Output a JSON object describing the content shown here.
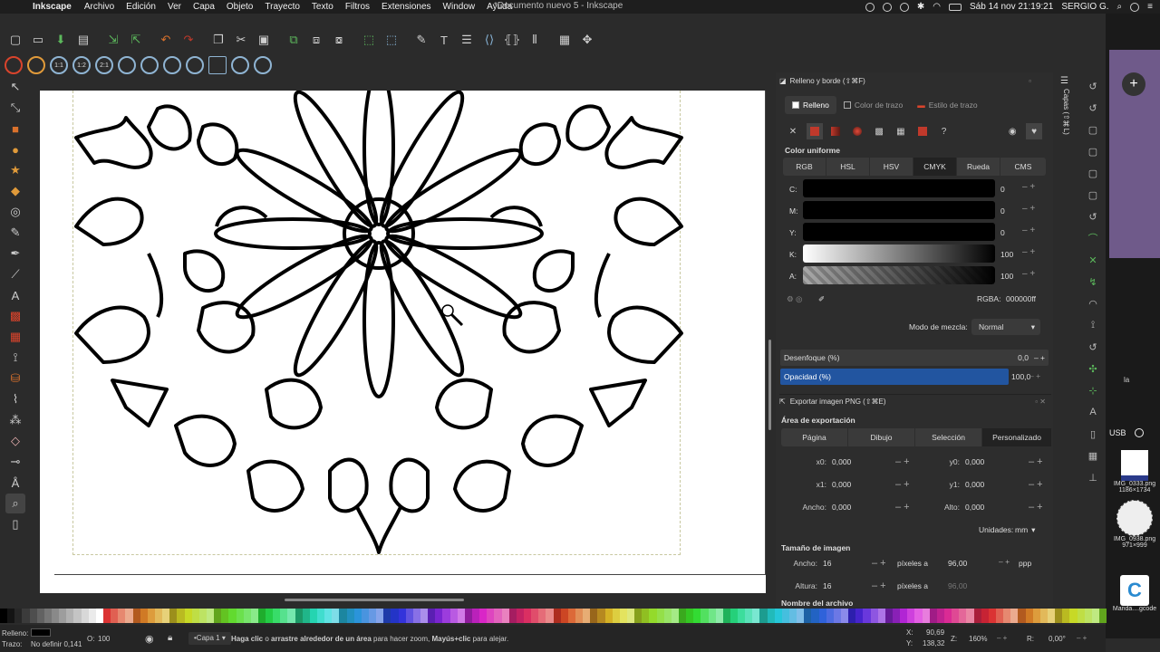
{
  "menubar": {
    "app": "Inkscape",
    "items": [
      "Archivo",
      "Edición",
      "Ver",
      "Capa",
      "Objeto",
      "Trayecto",
      "Texto",
      "Filtros",
      "Extensiones",
      "Window",
      "Ayuda"
    ],
    "doc_title": "*Documento nuevo 5 - Inkscape",
    "datetime": "Sáb 14 nov  21:19:21",
    "user": "SERGIO G."
  },
  "fill_stroke": {
    "title": "Relleno y borde (⇧⌘F)",
    "tabs": [
      "Relleno",
      "Color de trazo",
      "Estilo de trazo"
    ],
    "flat_label": "Color uniforme",
    "modes": [
      "RGB",
      "HSL",
      "HSV",
      "CMYK",
      "Rueda",
      "CMS"
    ],
    "channels": [
      {
        "label": "C:",
        "value": "0"
      },
      {
        "label": "M:",
        "value": "0"
      },
      {
        "label": "Y:",
        "value": "0"
      },
      {
        "label": "K:",
        "value": "100"
      },
      {
        "label": "A:",
        "value": "100"
      }
    ],
    "rgba_label": "RGBA:",
    "rgba": "000000ff",
    "blend_label": "Modo de mezcla:",
    "blend_value": "Normal",
    "blur_label": "Desenfoque (%)",
    "blur_value": "0,0",
    "opacity_label": "Opacidad (%)",
    "opacity_value": "100,0"
  },
  "export": {
    "title": "Exportar imagen PNG (⇧⌘E)",
    "area_label": "Área de exportación",
    "area_buttons": [
      "Página",
      "Dibujo",
      "Selección",
      "Personalizado"
    ],
    "x0_label": "x0:",
    "x0": "0,000",
    "y0_label": "y0:",
    "y0": "0,000",
    "x1_label": "x1:",
    "x1": "0,000",
    "y1_label": "y1:",
    "y1": "0,000",
    "width_label": "Ancho:",
    "width": "0,000",
    "height_label": "Alto:",
    "height": "0,000",
    "units_label": "Unidades:",
    "units": "mm",
    "image_size_label": "Tamaño de imagen",
    "img_w_label": "Ancho:",
    "img_w": "16",
    "img_h_label": "Altura:",
    "img_h": "16",
    "px_at": "píxeles a",
    "dpi": "96,00",
    "dpi2": "96,00",
    "ppp": "ppp",
    "filename_label": "Nombre del archivo"
  },
  "layers_label": "Capas (⇧⌘L)",
  "desktop": {
    "usb": "USB",
    "files": [
      {
        "name": "IMG_0333.png",
        "size": "1186×1734"
      },
      {
        "name": "IMG_0938.png",
        "size": "971×999"
      },
      {
        "name": "Manda....gcode",
        "size": ""
      }
    ],
    "side_label": "la"
  },
  "status": {
    "fill_label": "Relleno:",
    "stroke_label": "Trazo:",
    "stroke_value": "No definir 0,141",
    "opacity_label": "O:",
    "opacity": "100",
    "layer": "•Capa 1",
    "hint_bold1": "Haga clic",
    "hint1": " o ",
    "hint_bold2": "arrastre alrededor de un área",
    "hint2": " para hacer zoom, ",
    "hint_bold3": "Mayús+clic",
    "hint3": " para alejar.",
    "x_label": "X:",
    "x": "90,69",
    "y_label": "Y:",
    "y": "138,32",
    "z_label": "Z:",
    "zoom": "160%",
    "r_label": "R:",
    "rotation": "0,00°"
  },
  "colors": {
    "accent": "#2255a0",
    "red": "#c0392b"
  }
}
